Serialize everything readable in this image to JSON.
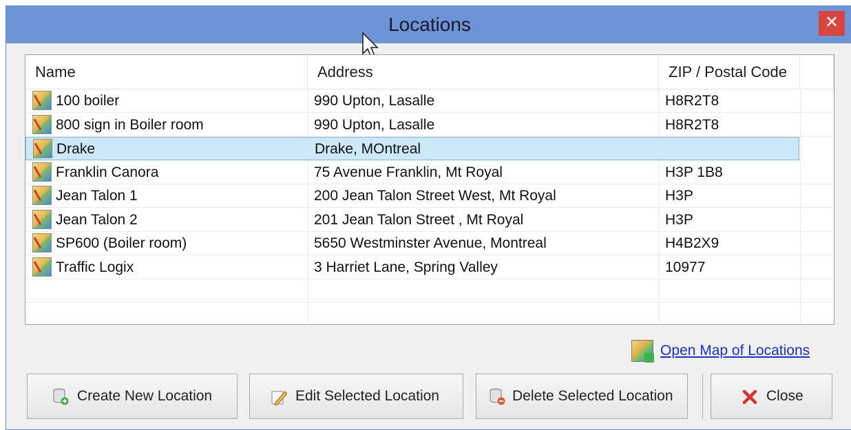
{
  "window": {
    "title": "Locations",
    "close_glyph": "✕"
  },
  "table": {
    "columns": [
      "Name",
      "Address",
      "ZIP / Postal Code"
    ],
    "rows": [
      {
        "name": "100 boiler",
        "address": "990 Upton, Lasalle",
        "zip": "H8R2T8"
      },
      {
        "name": "800 sign in Boiler room",
        "address": "990 Upton, Lasalle",
        "zip": "H8R2T8"
      },
      {
        "name": "Drake",
        "address": "Drake, MOntreal",
        "zip": ""
      },
      {
        "name": "Franklin Canora",
        "address": "75 Avenue Franklin, Mt Royal",
        "zip": "H3P 1B8"
      },
      {
        "name": "Jean Talon 1",
        "address": "200 Jean Talon Street West, Mt Royal",
        "zip": "H3P"
      },
      {
        "name": "Jean Talon 2",
        "address": "201 Jean Talon Street , Mt Royal",
        "zip": "H3P"
      },
      {
        "name": "SP600 (Boiler room)",
        "address": "5650 Westminster Avenue, Montreal",
        "zip": "H4B2X9"
      },
      {
        "name": "Traffic Logix",
        "address": "3 Harriet Lane, Spring Valley",
        "zip": "10977"
      }
    ],
    "selected_row": "Drake",
    "row_icon": "map-location-icon"
  },
  "map_link": {
    "label": "Open Map of Locations",
    "icon": "map-icon"
  },
  "buttons": {
    "create": "Create New Location",
    "edit": "Edit Selected Location",
    "delete": "Delete Selected Location",
    "close": "Close"
  },
  "colors": {
    "titlebar": "#6b93d6",
    "close_button": "#d9453f",
    "selection": "#cde8f7",
    "link": "#1a2fd8"
  }
}
